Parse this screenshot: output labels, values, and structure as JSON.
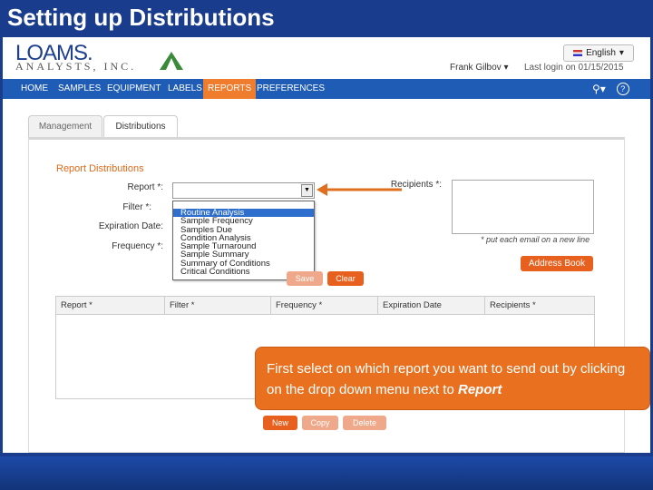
{
  "slide": {
    "title": "Setting up Distributions"
  },
  "app": {
    "logo_top": "LOAMS.",
    "logo_bottom": "ANALYSTS, INC.",
    "language": "English",
    "user": "Frank Gilbov",
    "last_login": "Last login on 01/15/2015",
    "nav": [
      "HOME",
      "SAMPLES",
      "EQUIPMENT",
      "LABELS",
      "REPORTS",
      "PREFERENCES"
    ],
    "active_nav": "REPORTS"
  },
  "tabs": [
    "Management",
    "Distributions"
  ],
  "form": {
    "section_title": "Report Distributions",
    "labels": {
      "report": "Report *:",
      "filter": "Filter *:",
      "expiration": "Expiration Date:",
      "frequency": "Frequency *:",
      "recipients": "Recipients *:"
    },
    "recipients_hint": "* put each email on a new line",
    "address_book": "Address Book",
    "save": "Save",
    "clear": "Clear",
    "report_options": [
      "Routine Analysis",
      "Sample Frequency",
      "Samples Due",
      "Condition Analysis",
      "Sample Turnaround",
      "Sample Summary",
      "Summary of Conditions",
      "Critical Conditions"
    ]
  },
  "table": {
    "headers": [
      "Report *",
      "Filter *",
      "Frequency *",
      "Expiration Date",
      "Recipients *"
    ]
  },
  "actions": {
    "new": "New",
    "copy": "Copy",
    "delete": "Delete"
  },
  "callout": {
    "text": "First select on which report you want to send out by clicking on the drop down menu next to ",
    "emphasis": "Report"
  },
  "colors": {
    "accent": "#e8701f",
    "nav": "#1f5cb6",
    "slide_bg": "#1a3c8c"
  }
}
